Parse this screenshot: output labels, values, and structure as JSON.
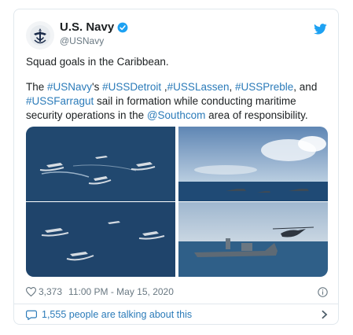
{
  "author": {
    "display_name": "U.S. Navy",
    "handle": "@USNavy",
    "verified_icon": "verified-badge-icon",
    "avatar_icon": "navy-seal-icon"
  },
  "tweet": {
    "line1": "Squad goals in the Caribbean.",
    "p2_the": "The ",
    "tag_usnavy": "#USNavy",
    "p2_s": "'s ",
    "tag_detroit": "#USSDetroit",
    "p2_comma1": " ,",
    "tag_lassen": "#USSLassen",
    "p2_comma2": ", ",
    "tag_preble": "#USSPreble",
    "p2_and": ", and ",
    "tag_farragut": "#USSFarragut",
    "p2_rest": " sail in formation while conducting maritime security operations in the ",
    "mention_southcom": "@Southcom",
    "p2_end": " area of responsibility."
  },
  "meta": {
    "likes": "3,373",
    "timestamp": "11:00 PM - May 15, 2020",
    "like_icon": "heart-icon",
    "info_icon": "info-icon"
  },
  "footer": {
    "talking": "1,555 people are talking about this",
    "reply_icon": "reply-bubble-icon",
    "chevron_icon": "chevron-right-icon"
  },
  "colors": {
    "link": "#2b7bb9",
    "twitter_blue": "#1da1f2",
    "ocean": "#1c3d5e",
    "text": "#1c2022",
    "muted": "#697882"
  }
}
